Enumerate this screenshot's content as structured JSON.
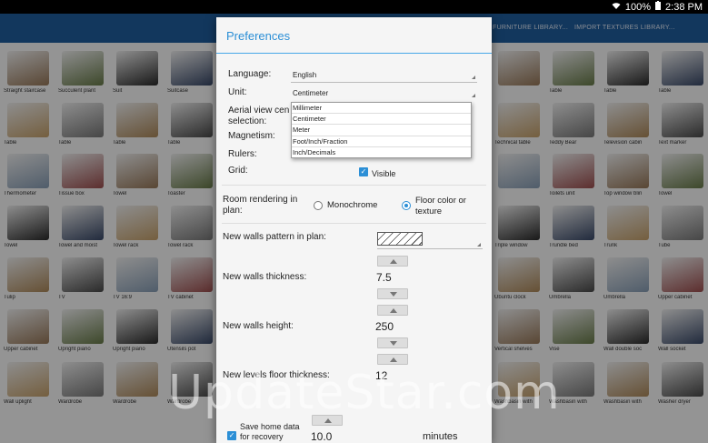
{
  "status": {
    "wifi": "wifi-icon",
    "battery_percent": "100%",
    "time": "2:38 PM"
  },
  "actionbar": {
    "actions": [
      "FURNITURE LIBRARY...",
      "IMPORT TEXTURES LIBRARY..."
    ]
  },
  "catalog": {
    "left": [
      [
        "Straight staircase",
        "Succulent plant",
        "Suit",
        "Suitcase"
      ],
      [
        "Table",
        "Table",
        "Table",
        "Table"
      ],
      [
        "Thermometer",
        "Tissue box",
        "Towel",
        "Toaster"
      ],
      [
        "Towel",
        "Towel and moist",
        "Towel rack",
        "Towel rack"
      ],
      [
        "Tulip",
        "TV",
        "TV 16:9",
        "TV cabinet"
      ],
      [
        "Upper cabinet",
        "Upright piano",
        "Upright piano",
        "Utensils pot"
      ],
      [
        "Wall uplight",
        "Wardrobe",
        "Wardrobe",
        "Wardrobe"
      ]
    ],
    "right": [
      [
        "",
        "Table",
        "Table",
        "Table"
      ],
      [
        "Technical table",
        "Teddy Bear",
        "Television cabin",
        "Text marker"
      ],
      [
        "",
        "Toilets unit",
        "Top window blin",
        "Towel"
      ],
      [
        "Triple window",
        "Trundle bed",
        "Trunk",
        "Tube"
      ],
      [
        "Ubuntu clock",
        "Umbrella",
        "Umbrella",
        "Upper cabinet"
      ],
      [
        "Vertical shelves",
        "Vise",
        "Wall double soc",
        "Wall socket"
      ],
      [
        "Washbasin with",
        "Washbasin with",
        "Washbasin with",
        "Washer dryer"
      ]
    ]
  },
  "dialog": {
    "title": "Preferences",
    "language": {
      "label": "Language:",
      "value": "English"
    },
    "unit": {
      "label": "Unit:",
      "value": "Centimeter",
      "options": [
        "Millimeter",
        "Centimeter",
        "Meter",
        "Foot/Inch/Fraction",
        "Inch/Decimals"
      ]
    },
    "aerial": {
      "label_line1": "Aerial view cen",
      "label_line2": "selection:"
    },
    "magnetism": {
      "label": "Magnetism:"
    },
    "rulers": {
      "label": "Rulers:"
    },
    "grid": {
      "label": "Grid:",
      "option": "Visible",
      "checked": true
    },
    "room_rendering": {
      "label_line1": "Room rendering in",
      "label_line2": "plan:",
      "option1": "Monochrome",
      "option2_line1": "Floor color or",
      "option2_line2": "texture",
      "selected": "Floor color or texture"
    },
    "walls_pattern": {
      "label": "New walls pattern in plan:"
    },
    "walls_thickness": {
      "label": "New walls thickness:",
      "value": "7.5"
    },
    "walls_height": {
      "label": "New walls height:",
      "value": "250"
    },
    "levels_floor": {
      "label": "New levels floor thickness:",
      "value": "12"
    },
    "recovery": {
      "label_line1": "Save home data",
      "label_line2": "for recovery",
      "value": "10.0",
      "unit": "minutes",
      "checked": true
    }
  },
  "watermark": "UpdateStar.com",
  "colors": {
    "accent": "#2c8fd6",
    "actionbar": "#1f5fa0"
  }
}
